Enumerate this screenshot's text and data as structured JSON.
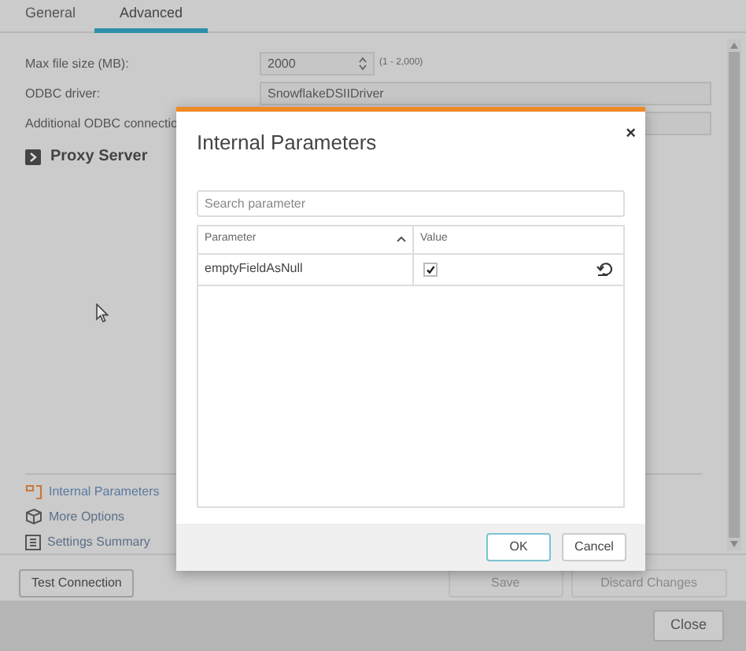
{
  "tabs": [
    {
      "label": "General",
      "selected": false
    },
    {
      "label": "Advanced",
      "selected": true
    }
  ],
  "fields": [
    {
      "kind": "spinner",
      "label": "Max file size (MB):",
      "value": "2000",
      "hint": "(1 - 2,000)"
    },
    {
      "kind": "text",
      "label": "ODBC driver:",
      "value": "SnowflakeDSIIDriver"
    },
    {
      "kind": "text",
      "label": "Additional ODBC connectio"
    }
  ],
  "section": {
    "title": "Proxy Server",
    "expanded": false
  },
  "links": [
    {
      "label": "Internal Parameters",
      "selected": true
    },
    {
      "label": "More Options",
      "selected": false
    },
    {
      "label": "Settings Summary",
      "selected": false
    }
  ],
  "footer_buttons": [
    {
      "label": "Test Connection",
      "disabled": false
    },
    {
      "label": "Save",
      "disabled": true
    },
    {
      "label": "Discard Changes",
      "disabled": true
    }
  ],
  "close_button": "Close",
  "dialog": {
    "title": "Internal Parameters",
    "close": "×",
    "search": {
      "placeholder": "Search parameter"
    },
    "columns": [
      {
        "label": "Parameter",
        "sorted": true
      },
      {
        "label": "Value",
        "sorted": false
      }
    ],
    "rows": [
      {
        "parameter": "emptyFieldAsNull",
        "checked": true
      }
    ],
    "buttons": [
      {
        "label": "OK",
        "default": true
      },
      {
        "label": "Cancel",
        "default": false
      }
    ]
  }
}
